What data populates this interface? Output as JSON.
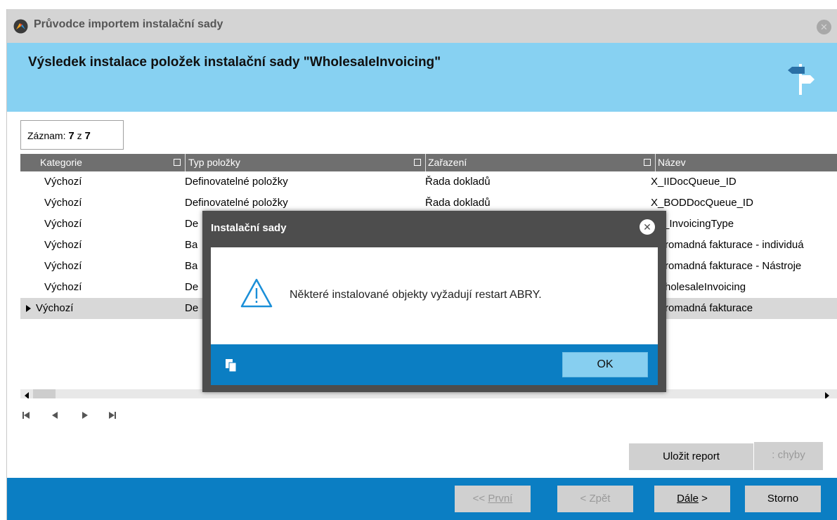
{
  "window": {
    "title": "Průvodce importem instalační sady",
    "header_title": "Výsledek instalace položek instalační sady \"WholesaleInvoicing\""
  },
  "record": {
    "label": "Záznam:",
    "current": "7",
    "sep": "z",
    "total": "7"
  },
  "grid": {
    "columns": [
      "Kategorie",
      "Typ položky",
      "Zařazení",
      "Název"
    ],
    "rows": [
      {
        "kategorie": "Výchozí",
        "typ": "Definovatelné položky",
        "zarazeni": "Řada dokladů",
        "nazev": "X_IIDocQueue_ID"
      },
      {
        "kategorie": "Výchozí",
        "typ": "Definovatelné položky",
        "zarazeni": "Řada dokladů",
        "nazev": "X_BODDocQueue_ID"
      },
      {
        "kategorie": "Výchozí",
        "typ": "De",
        "zarazeni": "",
        "nazev": "_InvoicingType"
      },
      {
        "kategorie": "Výchozí",
        "typ": "Ba",
        "zarazeni": "",
        "nazev": "romadná fakturace - individuá"
      },
      {
        "kategorie": "Výchozí",
        "typ": "Ba",
        "zarazeni": "",
        "nazev": "romadná fakturace - Nástroje"
      },
      {
        "kategorie": "Výchozí",
        "typ": "De",
        "zarazeni": "",
        "nazev": "holesaleInvoicing"
      },
      {
        "kategorie": "Výchozí",
        "typ": "De",
        "zarazeni": "",
        "nazev": "romadná fakturace"
      }
    ],
    "selected_row": 7
  },
  "buttons": {
    "save_report": "Uložit report",
    "errors": ": chyby",
    "first_prefix": "<< ",
    "first": "První",
    "back": "< Zpět",
    "next": "Dále",
    "next_suffix": " >",
    "cancel": "Storno"
  },
  "modal": {
    "title": "Instalační sady",
    "message": "Některé instalované objekty vyžadují restart ABRY.",
    "ok": "OK"
  },
  "icons": {
    "logo": "abra-logo-icon",
    "close": "close-icon",
    "signpost": "signpost-icon",
    "warning": "warning-icon",
    "copy": "copy-icon"
  },
  "colors": {
    "header_band": "#87d1f2",
    "footer_bar": "#0b7ec3",
    "grid_header": "#6f6f6f",
    "modal_frame": "#4d4d4d",
    "ok_button": "#87cff0"
  }
}
